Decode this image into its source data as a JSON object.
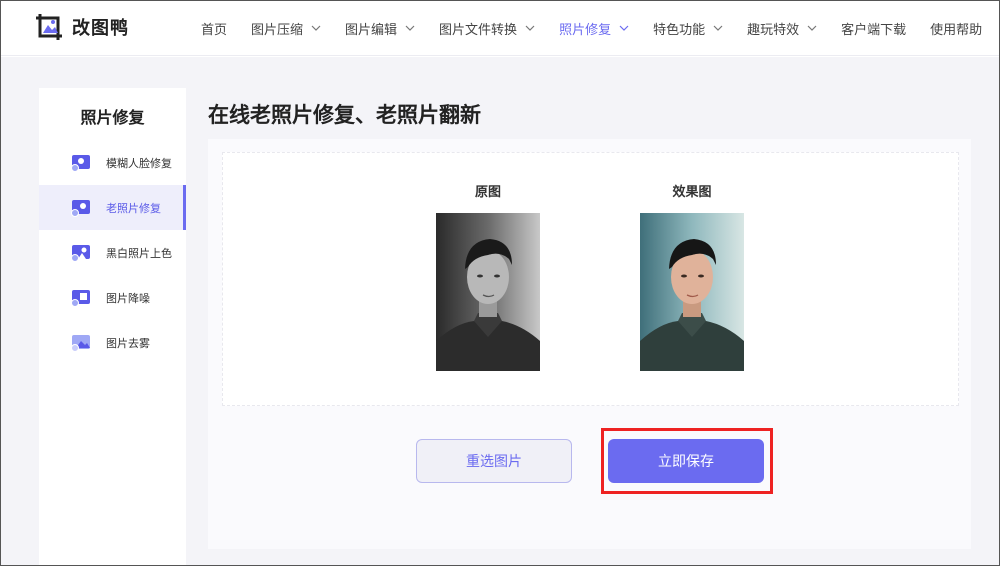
{
  "brand": {
    "name": "改图鸭",
    "logo_icon": "image-crop-logo-icon"
  },
  "nav": {
    "items": [
      {
        "label": "首页",
        "has_dropdown": false,
        "active": false
      },
      {
        "label": "图片压缩",
        "has_dropdown": true,
        "active": false
      },
      {
        "label": "图片编辑",
        "has_dropdown": true,
        "active": false
      },
      {
        "label": "图片文件转换",
        "has_dropdown": true,
        "active": false
      },
      {
        "label": "照片修复",
        "has_dropdown": true,
        "active": true
      },
      {
        "label": "特色功能",
        "has_dropdown": true,
        "active": false
      },
      {
        "label": "趣玩特效",
        "has_dropdown": true,
        "active": false
      },
      {
        "label": "客户端下载",
        "has_dropdown": false,
        "active": false
      },
      {
        "label": "使用帮助",
        "has_dropdown": false,
        "active": false
      }
    ]
  },
  "sidebar": {
    "title": "照片修复",
    "items": [
      {
        "label": "模糊人脸修复",
        "icon": "face-repair-icon",
        "active": false
      },
      {
        "label": "老照片修复",
        "icon": "old-photo-icon",
        "active": true
      },
      {
        "label": "黑白照片上色",
        "icon": "colorize-icon",
        "active": false
      },
      {
        "label": "图片降噪",
        "icon": "denoise-icon",
        "active": false
      },
      {
        "label": "图片去雾",
        "icon": "dehaze-icon",
        "active": false
      }
    ]
  },
  "main": {
    "title": "在线老照片修复、老照片翻新",
    "original_label": "原图",
    "result_label": "效果图",
    "reselect_label": "重选图片",
    "save_label": "立即保存"
  },
  "colors": {
    "accent": "#6b6bf0",
    "highlight": "#ee2222"
  }
}
